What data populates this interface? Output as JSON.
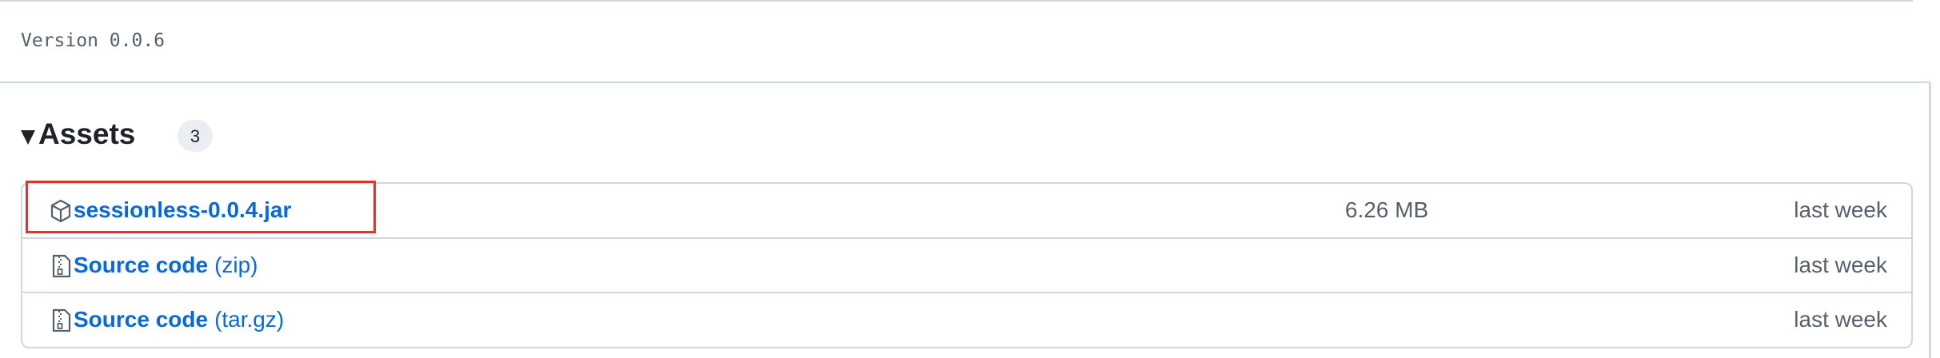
{
  "release": {
    "version_text": "Version 0.0.6"
  },
  "assets": {
    "title": "Assets",
    "count": "3",
    "items": [
      {
        "icon": "package-icon",
        "name": "sessionless-0.0.4.jar",
        "suffix": "",
        "size": "6.26 MB",
        "date": "last week",
        "highlighted": true
      },
      {
        "icon": "file-zip-icon",
        "name": "Source code",
        "suffix": "(zip)",
        "size": "",
        "date": "last week"
      },
      {
        "icon": "file-zip-icon",
        "name": "Source code",
        "suffix": "(tar.gz)",
        "size": "",
        "date": "last week"
      }
    ]
  },
  "colors": {
    "link": "#0969da",
    "muted_text": "#57606a",
    "border": "#d0d7de",
    "badge_bg": "#eaeef2",
    "highlight": "#e5332a"
  }
}
